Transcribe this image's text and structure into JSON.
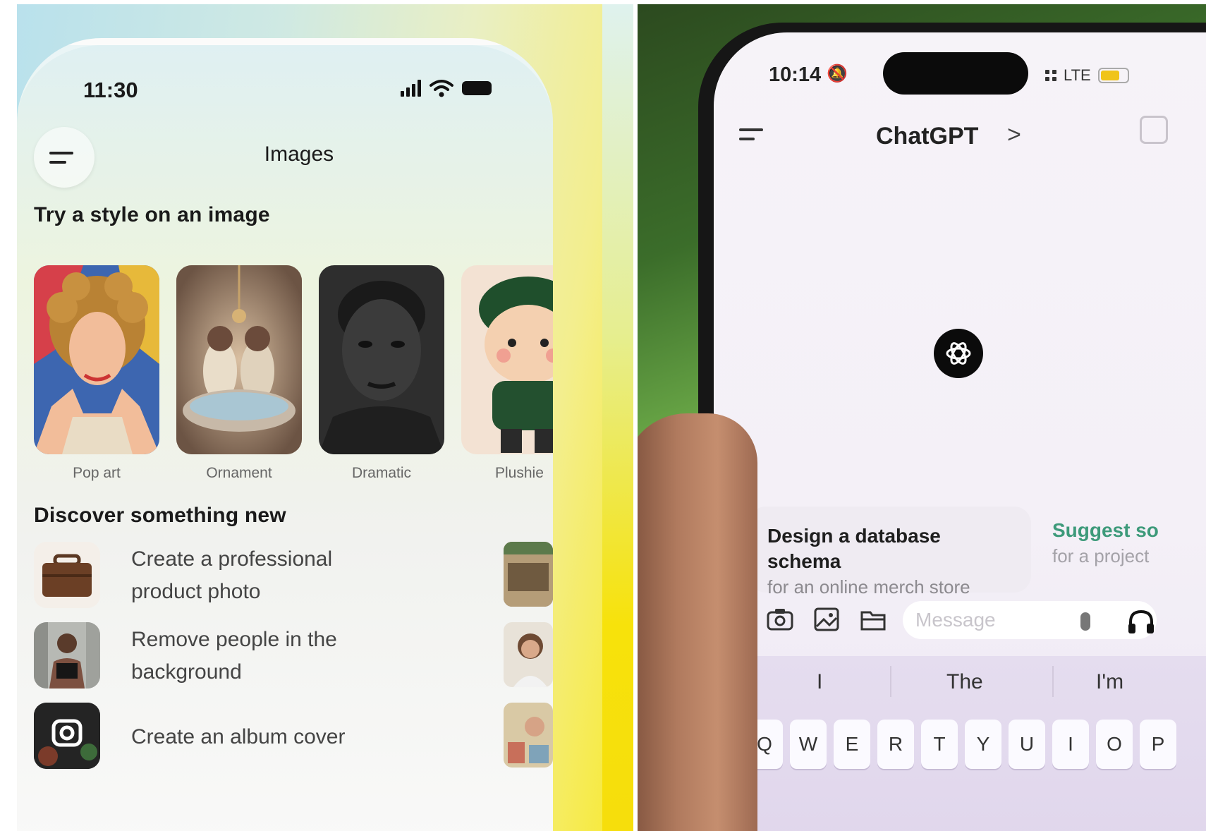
{
  "left_screen": {
    "status_time": "11:30",
    "header_title": "Images",
    "style_section_title": "Try a style on an image",
    "styles": [
      {
        "label": "Pop art"
      },
      {
        "label": "Ornament"
      },
      {
        "label": "Dramatic"
      },
      {
        "label": "Plushie"
      }
    ],
    "discover_section_title": "Discover something new",
    "discover_items": [
      {
        "line1": "Create a professional",
        "line2": "product photo"
      },
      {
        "line1": "Remove people in the",
        "line2": "background"
      },
      {
        "line1": "Create an album cover",
        "line2": ""
      }
    ]
  },
  "right_screen": {
    "status_time": "10:14",
    "network": "LTE",
    "header_title": "ChatGPT",
    "header_chevron": ">",
    "suggestions": [
      {
        "title": "Design a database schema",
        "subtitle": "for an online merch store"
      },
      {
        "title": "Suggest so",
        "subtitle": "for a project"
      }
    ],
    "message_placeholder": "Message",
    "predictions": [
      "I",
      "The",
      "I'm"
    ],
    "keys": [
      "Q",
      "W",
      "E",
      "R",
      "T",
      "Y",
      "U",
      "I",
      "O",
      "P"
    ],
    "colors": {
      "accent_green": "#3d9a7a",
      "battery": "#f0c419"
    }
  }
}
